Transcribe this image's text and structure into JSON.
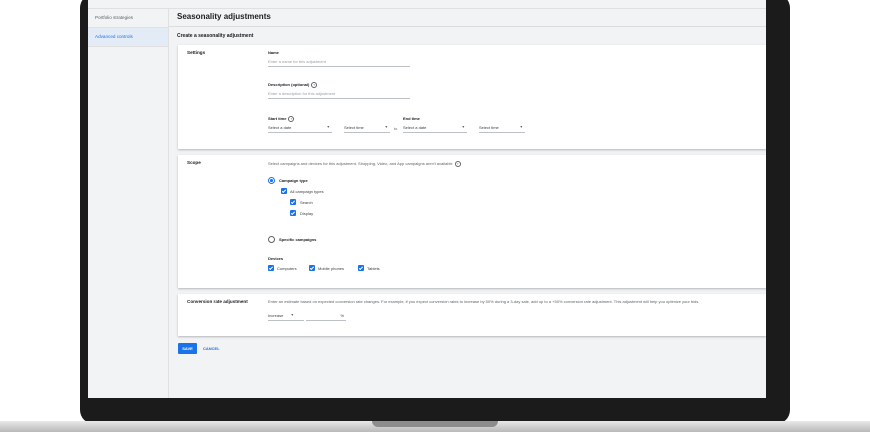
{
  "sidebar": {
    "items": [
      {
        "label": "Portfolio strategies"
      },
      {
        "label": "Advanced controls"
      }
    ]
  },
  "page": {
    "title": "Seasonality adjustments",
    "subtitle": "Create a seasonality adjustment"
  },
  "settings": {
    "section_label": "Settings",
    "name_label": "Name",
    "name_placeholder": "Enter a name for this adjustment",
    "description_label": "Description (optional)",
    "description_placeholder": "Enter a description for this adjustment",
    "start_label": "Start time",
    "end_label": "End time",
    "start_date": "Select a date",
    "start_time": "Select time",
    "to_text": "to",
    "end_date": "Select a date",
    "end_time": "Select time"
  },
  "scope": {
    "section_label": "Scope",
    "intro": "Select campaigns and devices for this adjustment. Shopping, Video, and App campaigns aren't available",
    "campaign_type_label": "Campaign type",
    "all_types_label": "All campaign types",
    "search_label": "Search",
    "display_label": "Display",
    "specific_label": "Specific campaigns",
    "devices_label": "Devices",
    "computers_label": "Computers",
    "mobile_label": "Mobile phones",
    "tablets_label": "Tablets"
  },
  "conversion": {
    "section_label": "Conversion rate adjustment",
    "description": "Enter an estimate based on expected conversion rate changes. For example, if you expect conversion rates to increase by 50% during a 3-day sale, add up to a +50% conversion rate adjustment. This adjustment will help you optimize your bids.",
    "direction": "Increase",
    "unit": "%"
  },
  "actions": {
    "save_label": "SAVE",
    "cancel_label": "CANCEL"
  },
  "colors": {
    "accent": "#1a73e8",
    "bezel": "#1b1b1b",
    "page_bg": "#f1f3f4"
  }
}
